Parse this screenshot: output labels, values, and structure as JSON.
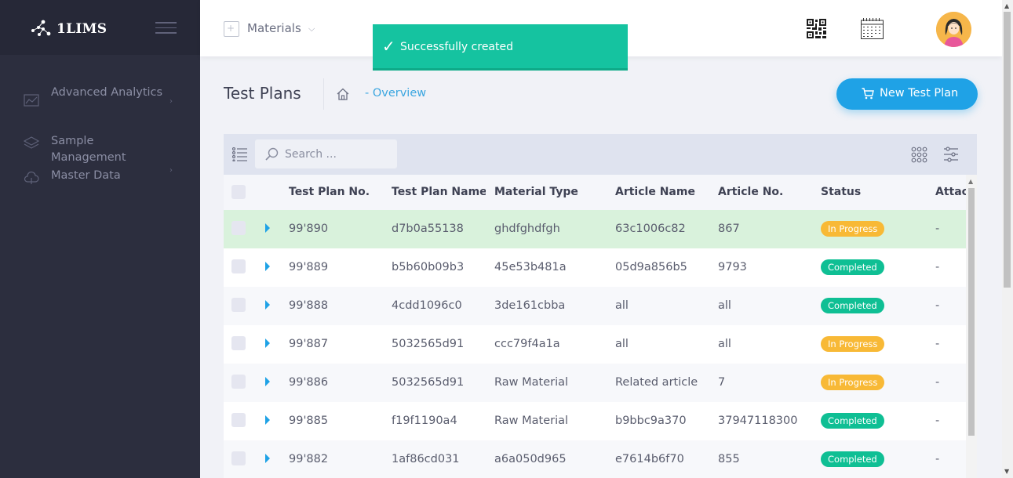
{
  "brand": {
    "name": "1LIMS"
  },
  "sidebar": {
    "items": [
      {
        "label": "Advanced Analytics",
        "icon": "analytics-icon",
        "has_submenu": true
      },
      {
        "label": "Sample Management",
        "icon": "layers-icon",
        "has_submenu": false
      },
      {
        "label": "Master Data",
        "icon": "cloud-icon",
        "has_submenu": true
      }
    ]
  },
  "header": {
    "module_label": "Materials",
    "icons": [
      "qr-code-icon",
      "calendar-icon",
      "avatar"
    ]
  },
  "toast": {
    "message": "Successfully created",
    "color": "#15c3a0"
  },
  "page": {
    "title": "Test Plans",
    "breadcrumb": "- Overview",
    "new_button_label": "New Test Plan"
  },
  "search": {
    "placeholder": "Search ..."
  },
  "table": {
    "columns": [
      "Test Plan No.",
      "Test Plan Name",
      "Material Type",
      "Article Name",
      "Article No.",
      "Status",
      "Attac"
    ],
    "rows": [
      {
        "no": "99'890",
        "name": "d7b0a55138",
        "material": "ghdfghdfgh",
        "article": "63c1006c82",
        "article_no": "867",
        "status": "In Progress",
        "attachments": "-"
      },
      {
        "no": "99'889",
        "name": "b5b60b09b3",
        "material": "45e53b481a",
        "article": "05d9a856b5",
        "article_no": "9793",
        "status": "Completed",
        "attachments": "-"
      },
      {
        "no": "99'888",
        "name": "4cdd1096c0",
        "material": "3de161cbba",
        "article": "all",
        "article_no": "all",
        "status": "Completed",
        "attachments": "-"
      },
      {
        "no": "99'887",
        "name": "5032565d91",
        "material": "ccc79f4a1a",
        "article": "all",
        "article_no": "all",
        "status": "In Progress",
        "attachments": "-"
      },
      {
        "no": "99'886",
        "name": "5032565d91",
        "material": "Raw Material",
        "article": "Related article t",
        "article_no": "7",
        "status": "In Progress",
        "attachments": "-"
      },
      {
        "no": "99'885",
        "name": "f19f1190a4",
        "material": "Raw Material",
        "article": "b9bbc9a370",
        "article_no": "37947118300",
        "status": "Completed",
        "attachments": "-"
      },
      {
        "no": "99'882",
        "name": "1af86cd031",
        "material": "a6a050d965",
        "article": "e7614b6f70",
        "article_no": "855",
        "status": "Completed",
        "attachments": "-"
      }
    ]
  },
  "colors": {
    "sidebar_bg": "#2c2e3e",
    "accent": "#1fa2e6",
    "status_in_progress": "#f8b936",
    "status_completed": "#0fbf94",
    "row_highlight": "#d9f2dc"
  }
}
